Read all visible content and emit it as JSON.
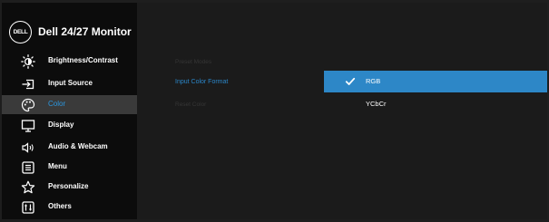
{
  "header": {
    "logo_text": "DELL",
    "title": "Dell 24/27 Monitor"
  },
  "sidebar": {
    "items": [
      {
        "label": "Brightness/Contrast",
        "icon": "brightness-icon"
      },
      {
        "label": "Input Source",
        "icon": "input-source-icon"
      },
      {
        "label": "Color",
        "icon": "palette-icon",
        "active": true
      },
      {
        "label": "Display",
        "icon": "display-icon"
      },
      {
        "label": "Audio & Webcam",
        "icon": "speaker-icon"
      },
      {
        "label": "Menu",
        "icon": "menu-icon"
      },
      {
        "label": "Personalize",
        "icon": "star-icon"
      },
      {
        "label": "Others",
        "icon": "others-icon"
      }
    ]
  },
  "submenu": {
    "items": [
      {
        "label": "Preset Modes",
        "state": "disabled"
      },
      {
        "label": "Input Color Format",
        "state": "active"
      },
      {
        "label": "Reset Color",
        "state": "disabled"
      }
    ]
  },
  "options": {
    "items": [
      {
        "label": "RGB",
        "selected": true
      },
      {
        "label": "YCbCr",
        "selected": false
      }
    ]
  },
  "colors": {
    "sidebar_bg": "#0c0c0c",
    "panel_bg": "#1b1b1b",
    "accent": "#2d87c7",
    "active_text": "#2b97e0",
    "active_item_bg": "#3a3a3a"
  }
}
